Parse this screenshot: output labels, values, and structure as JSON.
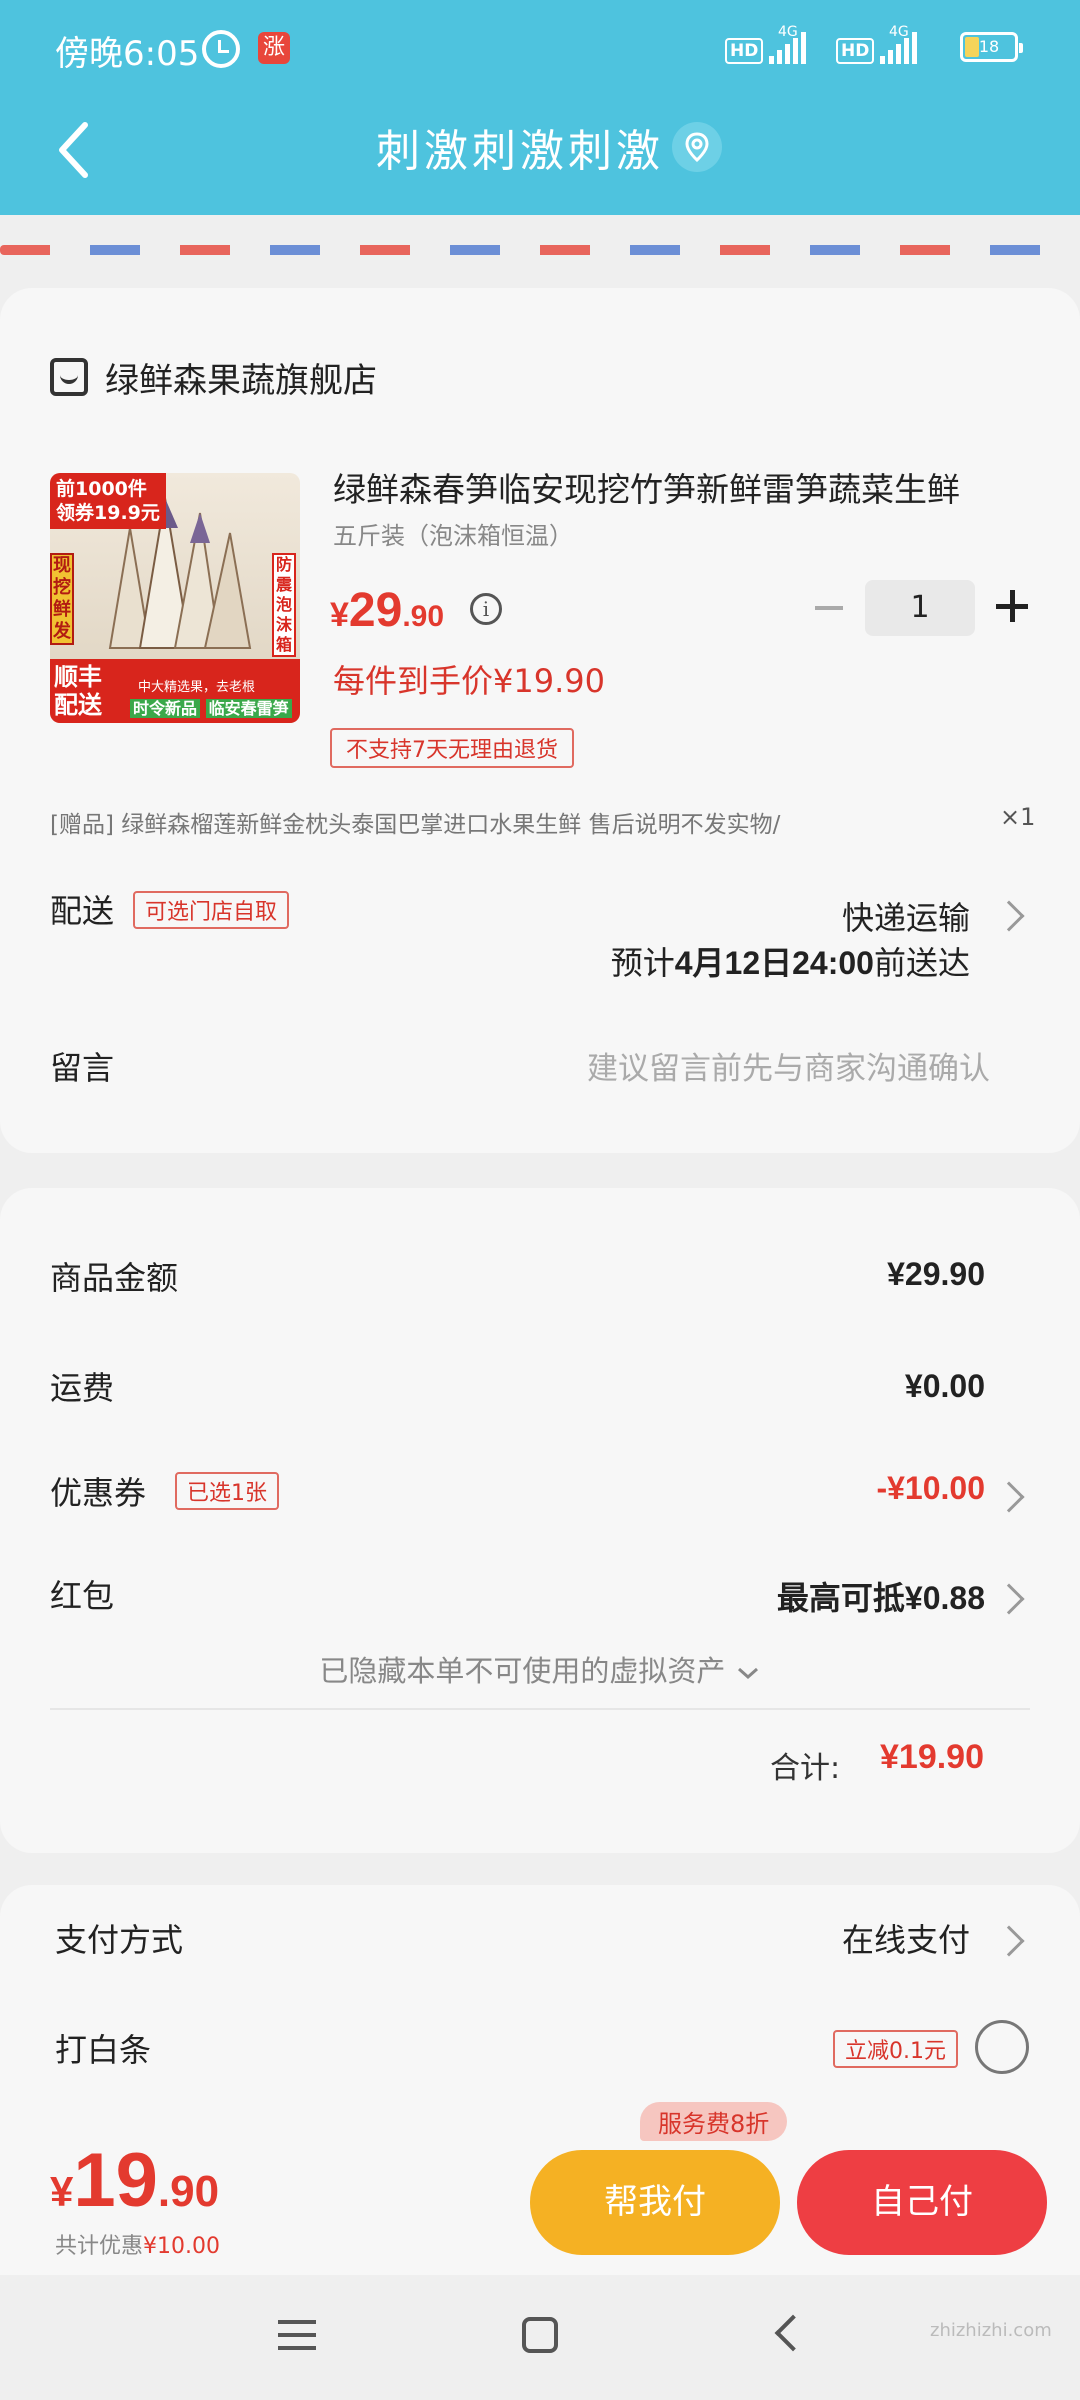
{
  "colors": {
    "header_bg": "#4ec3de",
    "accent_red": "#e33a2f",
    "pay_friend_bg": "#f5b123",
    "pay_self_bg": "#ee3e43"
  },
  "status_bar": {
    "time": "傍晚6:05",
    "app_badge": "涨",
    "network_1": "HD",
    "network_2": "HD",
    "signal_type_1": "4G",
    "signal_type_2": "4G",
    "battery": "18"
  },
  "nav": {
    "title": "刺激刺激刺激"
  },
  "store": {
    "name": "绿鲜森果蔬旗舰店"
  },
  "product": {
    "image_top_badge": "前1000件\n领券19.9元",
    "image_left_label": "现挖鲜发",
    "image_right_label": "防震泡沫箱",
    "image_shipping": "顺丰\n配送",
    "image_quality": "中大精选果，去老根",
    "image_season_prefix": "时令新品",
    "image_season": "临安春雷笋",
    "title": "绿鲜森春笋临安现挖竹笋新鲜雷笋蔬菜生鲜",
    "spec": "五斤装（泡沫箱恒温）",
    "price_symbol": "¥",
    "price_int": "29",
    "price_dec": ".90",
    "quantity": "1",
    "unit_price": "每件到手价¥19.90",
    "return_policy": "不支持7天无理由退货"
  },
  "gift": {
    "text": "[赠品]   绿鲜森榴莲新鲜金枕头泰国巴掌进口水果生鲜  售后说明不发实物/",
    "count": "×1"
  },
  "delivery": {
    "label": "配送",
    "tag": "可选门店自取",
    "method": "快递运输",
    "eta_prefix": "预计",
    "eta_date": "4月12日24:00",
    "eta_suffix": "前送达"
  },
  "message": {
    "label": "留言",
    "placeholder": "建议留言前先与商家沟通确认"
  },
  "summary": {
    "goods_label": "商品金额",
    "goods_value": "¥29.90",
    "shipping_label": "运费",
    "shipping_value": "¥0.00",
    "coupon_label": "优惠券",
    "coupon_tag": "已选1张",
    "coupon_value": "-¥10.00",
    "redpacket_label": "红包",
    "redpacket_value": "最高可抵¥0.88",
    "hidden_assets": "已隐藏本单不可使用的虚拟资产",
    "total_label": "合计:",
    "total_value": "¥19.90"
  },
  "payment": {
    "method_label": "支付方式",
    "method_value": "在线支付",
    "baitiao_label": "打白条",
    "baitiao_tag": "立减0.1元"
  },
  "bottom": {
    "price_symbol": "¥",
    "price_int": "19",
    "price_dec": ".90",
    "saved_label": "共计优惠",
    "saved_value": "¥10.00",
    "service_tag": "服务费8折",
    "pay_friend": "帮我付",
    "pay_self": "自己付"
  },
  "watermark": "zhizhizhi.com"
}
